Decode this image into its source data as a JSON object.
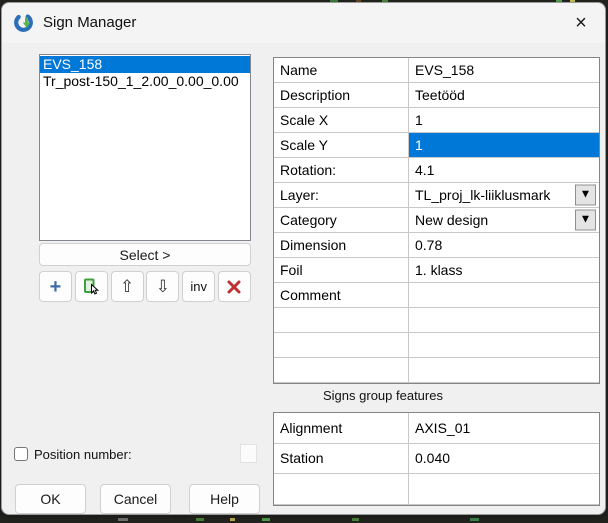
{
  "window": {
    "title": "Sign Manager"
  },
  "icons": {
    "close": "×",
    "add": "+",
    "move_up": "⇧",
    "move_down": "⇩",
    "invert": "inv",
    "dropdown": "▼"
  },
  "sign_list": {
    "items": [
      {
        "label": "EVS_158",
        "selected": true
      },
      {
        "label": "Tr_post-150_1_2.00_0.00_0.00",
        "selected": false
      }
    ]
  },
  "buttons": {
    "select": "Select >",
    "ok": "OK",
    "cancel": "Cancel",
    "help": "Help"
  },
  "properties_table": {
    "rows": [
      {
        "label": "Name",
        "value": "EVS_158"
      },
      {
        "label": "Description",
        "value": "Teetööd"
      },
      {
        "label": "Scale X",
        "value": "1"
      },
      {
        "label": "Scale Y",
        "value": "1",
        "highlighted": true
      },
      {
        "label": "Rotation:",
        "value": "4.1"
      },
      {
        "label": "Layer:",
        "value": "TL_proj_lk-liiklusmark",
        "dropdown": true
      },
      {
        "label": "Category",
        "value": "New design",
        "dropdown": true
      },
      {
        "label": "Dimension",
        "value": "0.78"
      },
      {
        "label": "Foil",
        "value": "1. klass"
      },
      {
        "label": "Comment",
        "value": ""
      },
      {
        "label": "",
        "value": ""
      },
      {
        "label": "",
        "value": ""
      },
      {
        "label": "",
        "value": ""
      }
    ]
  },
  "group_features": {
    "title": "Signs group features",
    "rows": [
      {
        "label": "Alignment",
        "value": "AXIS_01"
      },
      {
        "label": "Station",
        "value": "0.040"
      },
      {
        "label": "",
        "value": ""
      }
    ]
  },
  "position_number": {
    "label": "Position number:",
    "checked": false
  },
  "colors": {
    "selection_blue": "#0078d7",
    "add_icon_blue": "#3b6ea5",
    "pick_icon_green": "#3f9e3f",
    "delete_icon_red": "#bf3232",
    "logo_blue": "#2a6fb8",
    "logo_green": "#57b947"
  }
}
